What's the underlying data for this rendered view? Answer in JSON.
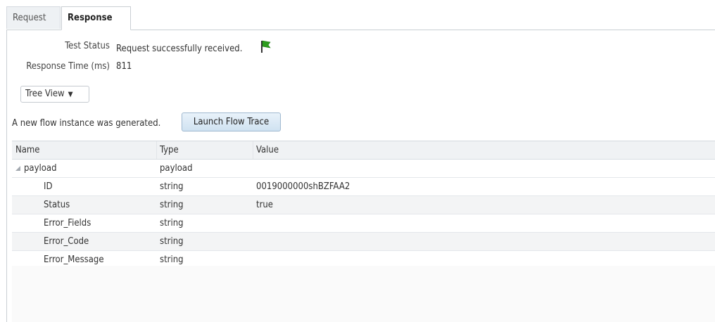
{
  "tabs": {
    "request": "Request",
    "response": "Response"
  },
  "test_status": {
    "label": "Test Status",
    "value": "Request successfully received."
  },
  "response_time": {
    "label": "Response Time (ms)",
    "value": "811"
  },
  "view_select": {
    "selected": "Tree View",
    "arrow": "▼"
  },
  "flow": {
    "message": "A new flow instance was generated.",
    "button_label": "Launch Flow Trace"
  },
  "table": {
    "headers": {
      "name": "Name",
      "type": "Type",
      "value": "Value"
    },
    "rows": [
      {
        "name": "payload",
        "type": "payload",
        "value": ""
      },
      {
        "name": "ID",
        "type": "string",
        "value": "0019000000shBZFAA2"
      },
      {
        "name": "Status",
        "type": "string",
        "value": "true"
      },
      {
        "name": "Error_Fields",
        "type": "string",
        "value": ""
      },
      {
        "name": "Error_Code",
        "type": "string",
        "value": ""
      },
      {
        "name": "Error_Message",
        "type": "string",
        "value": ""
      }
    ]
  },
  "colors": {
    "flag_green": "#2e9e1f",
    "button_border": "#9fb8cf"
  },
  "icons": {
    "status_flag": "green-flag-icon",
    "tree_expander": "expanded-triangle-icon"
  }
}
